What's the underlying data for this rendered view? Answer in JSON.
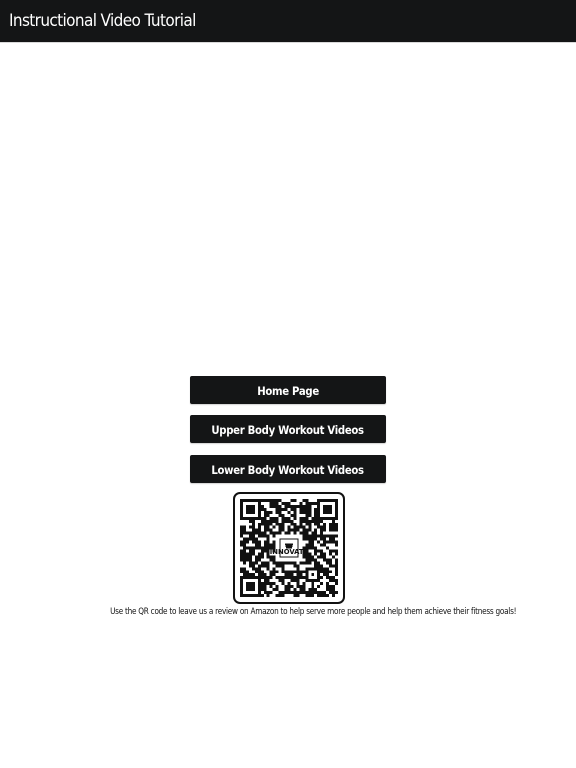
{
  "header": {
    "title": "Instructional Video Tutorial"
  },
  "buttons": {
    "home": "Home Page",
    "upper_body": "Upper Body Workout Videos",
    "lower_body": "Lower Body Workout Videos"
  },
  "qr": {
    "caption": "Use the QR code to leave us a review on Amazon to help serve more people and help them achieve their fitness goals!",
    "center_logo_icon": "fitness-logo-icon",
    "center_logo_text": "INNOVATE"
  },
  "colors": {
    "header_background": "#141516",
    "button_background": "#141516",
    "button_text": "#ffffff",
    "page_background": "#ffffff",
    "qr_dark": "#111111"
  }
}
